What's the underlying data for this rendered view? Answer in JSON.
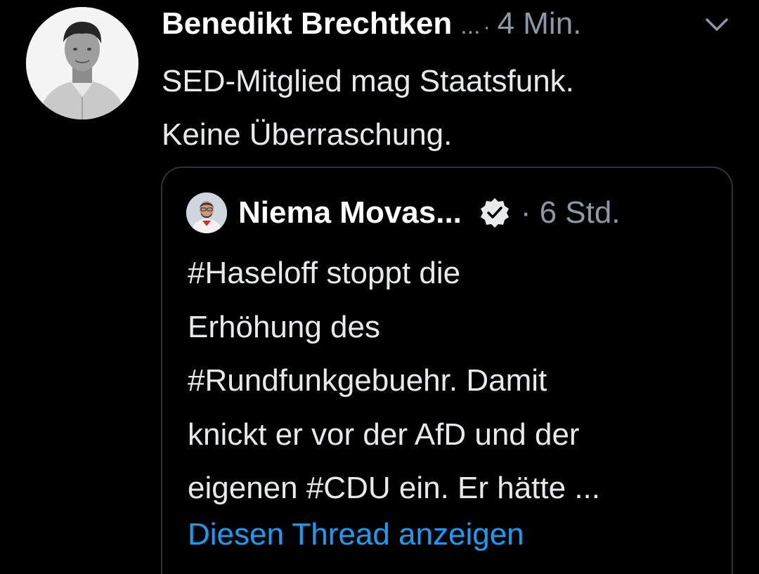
{
  "tweet": {
    "author": {
      "name": "Benedikt Brechtken",
      "truncation": "...",
      "separator": "·",
      "avatar_icon": "profile-photo"
    },
    "timestamp": "4 Min.",
    "menu_icon": "chevron-down-icon",
    "text": "SED-Mitglied mag Staatsfunk.\nKeine Überraschung."
  },
  "quote": {
    "author": {
      "name": "Niema Movas...",
      "verified_icon": "verified-badge-icon",
      "avatar_icon": "profile-photo"
    },
    "separator": "·",
    "timestamp": "6 Std.",
    "text": "#Haseloff stoppt die\nErhöhung des\n#Rundfunkgebuehr. Damit\nknickt er vor der AfD und der\neigenen #CDU ein. Er hätte ...",
    "thread_link": "Diesen Thread anzeigen"
  },
  "colors": {
    "background": "#000000",
    "primary_text": "#e7e9ea",
    "secondary_text": "#8b98a5",
    "link": "#1d9bf0",
    "border": "#2f3336"
  }
}
